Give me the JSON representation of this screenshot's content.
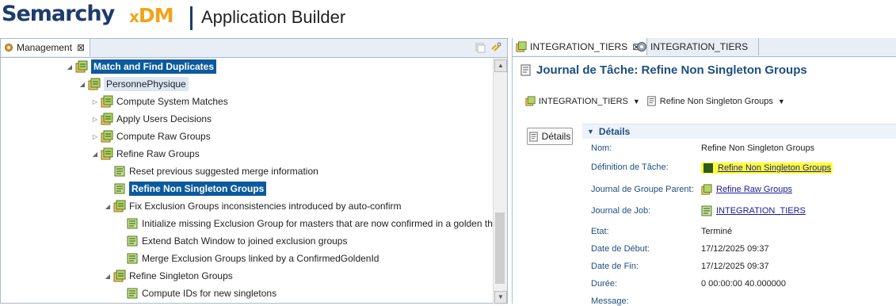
{
  "header": {
    "logo_word": "Semarchy",
    "logo_x": "x",
    "logo_dm": "DM",
    "app_title": "Application Builder"
  },
  "left_panel": {
    "tab_label": "Management",
    "tree": [
      {
        "label": "Match and Find Duplicates",
        "style": "selected"
      },
      {
        "label": "PersonnePhysique",
        "style": "parent-selected"
      },
      {
        "label": "Compute System Matches"
      },
      {
        "label": "Apply Users Decisions"
      },
      {
        "label": "Compute Raw Groups"
      },
      {
        "label": "Refine Raw Groups"
      },
      {
        "label": "Reset previous suggested merge information"
      },
      {
        "label": "Refine Non Singleton Groups",
        "style": "selected"
      },
      {
        "label": "Fix Exclusion Groups inconsistencies introduced by auto-confirm"
      },
      {
        "label": "Initialize missing Exclusion Group for masters that are now confirmed in a golden that alrea"
      },
      {
        "label": "Extend Batch Window to joined exclusion groups"
      },
      {
        "label": "Merge Exclusion Groups linked by a ConfirmedGoldenId"
      },
      {
        "label": "Refine Singleton Groups"
      },
      {
        "label": "Compute IDs for new singletons"
      }
    ]
  },
  "right_panel": {
    "tabs": [
      {
        "label": "INTEGRATION_TIERS",
        "active": true
      },
      {
        "label": "INTEGRATION_TIERS",
        "active": false
      }
    ],
    "title": "Journal de Tâche: Refine Non Singleton Groups",
    "crumb_job": "INTEGRATION_TIERS",
    "crumb_task": "Refine Non Singleton Groups",
    "details_button": "Détails",
    "section_title": "Détails",
    "fields": {
      "nom_label": "Nom:",
      "nom_value": "Refine Non Singleton Groups",
      "def_label": "Définition de Tâche:",
      "def_value": "Refine Non Singleton Groups",
      "parent_label": "Journal de Groupe Parent:",
      "parent_value": "Refine Raw Groups",
      "job_label": "Journal de Job:",
      "job_value": "INTEGRATION_TIERS",
      "etat_label": "Etat:",
      "etat_value": "Terminé",
      "debut_label": "Date de Début:",
      "debut_value": "17/12/2025 09:37",
      "fin_label": "Date de Fin:",
      "fin_value": "17/12/2025 09:37",
      "duree_label": "Durée:",
      "duree_value": "0 00:00:00 40.000000",
      "message_label": "Message:"
    }
  },
  "colors": {
    "brand_navy": "#1d3b6e",
    "brand_orange": "#f2a31b",
    "selection_blue": "#0c5a9e",
    "highlight_yellow": "#ffff33"
  }
}
